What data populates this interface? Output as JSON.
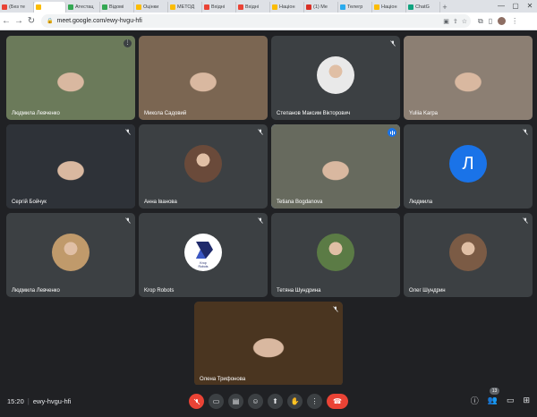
{
  "browser": {
    "tabs": [
      {
        "label": "(Без те",
        "color": "#ea4335"
      },
      {
        "label": "",
        "color": "#fbbc04",
        "active": true
      },
      {
        "label": "Атестац",
        "color": "#34a853"
      },
      {
        "label": "Відомі",
        "color": "#34a853"
      },
      {
        "label": "Оцінки",
        "color": "#fbbc04"
      },
      {
        "label": "МЕТОД",
        "color": "#fbbc04"
      },
      {
        "label": "Вхідні",
        "color": "#ea4335"
      },
      {
        "label": "Вхідні",
        "color": "#ea4335"
      },
      {
        "label": "Націон",
        "color": "#fbbc04"
      },
      {
        "label": "(1) Me",
        "color": "#d93025"
      },
      {
        "label": "Телегр",
        "color": "#2aabee"
      },
      {
        "label": "Націон",
        "color": "#fbbc04"
      },
      {
        "label": "ChatG",
        "color": "#10a37f"
      }
    ],
    "url": "meet.google.com/ewy-hvgu-hfi"
  },
  "participants": [
    {
      "name": "Людмила Левченко",
      "type": "video",
      "bg": "#6b7a5a"
    },
    {
      "name": "Микола Садовий",
      "type": "video",
      "bg": "#7b6652"
    },
    {
      "name": "Степанов Максим Вікторович",
      "type": "photo",
      "photo_bg": "#e9e9e9"
    },
    {
      "name": "Yuliia Karpa",
      "type": "video",
      "bg": "#8c7f73"
    },
    {
      "name": "Сергій Бойчук",
      "type": "video",
      "bg": "#2e3238"
    },
    {
      "name": "Анна Іванова",
      "type": "photo",
      "photo_bg": "#6a4a3a"
    },
    {
      "name": "Tetiana Bogdanova",
      "type": "video",
      "bg": "#676a5e"
    },
    {
      "name": "Людмила",
      "type": "letter",
      "letter": "Л"
    },
    {
      "name": "Людмила Левченко",
      "type": "photo",
      "photo_bg": "#c09a6b"
    },
    {
      "name": "Krop Robots",
      "type": "logo",
      "logo_text": "Krop\nRobots"
    },
    {
      "name": "Тетяна Шундрина",
      "type": "photo",
      "photo_bg": "#5b7b45"
    },
    {
      "name": "Олег Шундрин",
      "type": "photo",
      "photo_bg": "#7b5b45"
    },
    {
      "name": "Олена Трифонова",
      "type": "video",
      "bg": "#4a3520"
    }
  ],
  "bottom": {
    "time": "15:20",
    "separator": "|",
    "meeting_code": "ewy-hvgu-hfi",
    "participant_count": "13"
  },
  "colors": {
    "accent": "#1a73e8",
    "hangup": "#ea4335",
    "tile": "#3c4043"
  }
}
